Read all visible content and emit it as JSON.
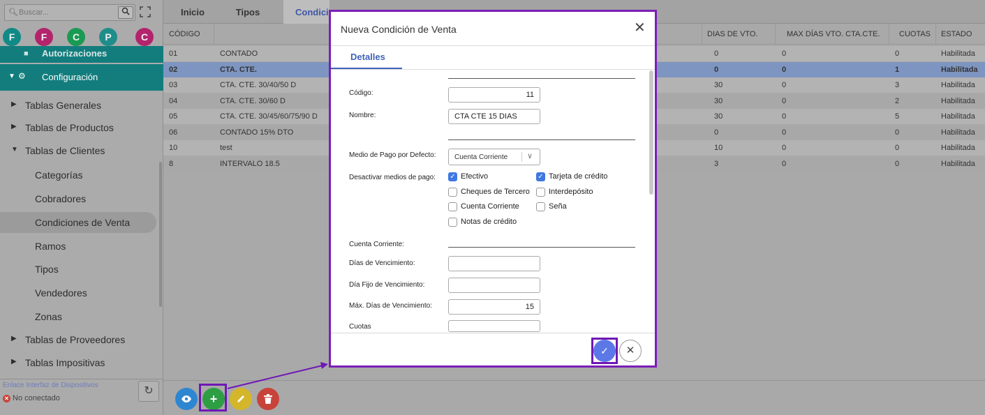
{
  "sidebar": {
    "search_placeholder": "Buscar...",
    "circles": [
      {
        "letter": "F",
        "color": "#0f8a87"
      },
      {
        "letter": "F",
        "color": "#b3246d"
      },
      {
        "letter": "C",
        "color": "#1a9a52"
      },
      {
        "letter": "P",
        "color": "#1f8e8a"
      },
      {
        "letter": "C",
        "color": "#b3246d"
      }
    ],
    "autorizaciones": "Autorizaciones",
    "configuracion": "Configuración",
    "items": [
      {
        "label": "Tablas Generales"
      },
      {
        "label": "Tablas de Productos"
      },
      {
        "label": "Tablas de Clientes"
      }
    ],
    "subitems": [
      {
        "label": "Categorías"
      },
      {
        "label": "Cobradores"
      },
      {
        "label": "Condiciones de Venta"
      },
      {
        "label": "Ramos"
      },
      {
        "label": "Tipos"
      },
      {
        "label": "Vendedores"
      },
      {
        "label": "Zonas"
      }
    ],
    "items_after": [
      {
        "label": "Tablas de Proveedores"
      },
      {
        "label": "Tablas Impositivas"
      }
    ],
    "device_link_label": "Enlace Interfaz de Dispositivos",
    "device_status": "No conectado"
  },
  "tabs": [
    {
      "label": "Inicio"
    },
    {
      "label": "Tipos"
    },
    {
      "label": "Condici"
    }
  ],
  "table": {
    "headers": {
      "codigo": "CÓDIGO",
      "dias_vto": "DIAS DE VTO.",
      "max_dias": "MAX DÍAS VTO. CTA.CTE.",
      "cuotas": "CUOTAS",
      "estado": "ESTADO"
    },
    "rows": [
      {
        "codigo": "01",
        "nombre": "CONTADO",
        "dias": "0",
        "max": "0",
        "cuotas": "0",
        "estado": "Habilitada"
      },
      {
        "codigo": "02",
        "nombre": "CTA. CTE.",
        "dias": "0",
        "max": "0",
        "cuotas": "1",
        "estado": "Habilitada"
      },
      {
        "codigo": "03",
        "nombre": "CTA. CTE. 30/40/50 D",
        "dias": "30",
        "max": "0",
        "cuotas": "3",
        "estado": "Habilitada"
      },
      {
        "codigo": "04",
        "nombre": "CTA. CTE. 30/60 D",
        "dias": "30",
        "max": "0",
        "cuotas": "2",
        "estado": "Habilitada"
      },
      {
        "codigo": "05",
        "nombre": "CTA. CTE. 30/45/60/75/90 D",
        "dias": "30",
        "max": "0",
        "cuotas": "5",
        "estado": "Habilitada"
      },
      {
        "codigo": "06",
        "nombre": "CONTADO 15% DTO",
        "dias": "0",
        "max": "0",
        "cuotas": "0",
        "estado": "Habilitada"
      },
      {
        "codigo": "10",
        "nombre": "test",
        "dias": "10",
        "max": "0",
        "cuotas": "0",
        "estado": "Habilitada"
      },
      {
        "codigo": "8",
        "nombre": "INTERVALO 18.5",
        "dias": "3",
        "max": "0",
        "cuotas": "0",
        "estado": "Habilitada"
      }
    ]
  },
  "actions": {
    "view_icon": "eye-icon",
    "add_icon": "plus-icon",
    "edit_icon": "pencil-icon",
    "delete_icon": "trash-icon",
    "colors": {
      "view": "#2e86d1",
      "add": "#2e9e45",
      "edit": "#d4b62a",
      "delete": "#c8433a"
    }
  },
  "modal": {
    "title": "Nueva Condición de Venta",
    "tab": "Detalles",
    "codigo_label": "Código:",
    "codigo_value": "11",
    "nombre_label": "Nombre:",
    "nombre_value": "CTA CTE 15 DIAS",
    "medio_label": "Medio de Pago por Defecto:",
    "medio_value": "Cuenta Corriente",
    "desactivar_label": "Desactivar medios de pago:",
    "checkboxes": [
      {
        "label": "Efectivo",
        "checked": true
      },
      {
        "label": "Tarjeta de crédito",
        "checked": true
      },
      {
        "label": "Cheques de Tercero",
        "checked": false
      },
      {
        "label": "Interdepósito",
        "checked": false
      },
      {
        "label": "Cuenta Corriente",
        "checked": false
      },
      {
        "label": "Seña",
        "checked": false
      },
      {
        "label": "Notas de crédito",
        "checked": false
      }
    ],
    "cuenta_corriente_label": "Cuenta Corriente:",
    "dias_venc_label": "Días de Vencimiento:",
    "dias_venc_value": "",
    "dia_fijo_label": "Día Fijo de Vencimiento:",
    "dia_fijo_value": "",
    "max_dias_label": "Máx. Días de Vencimiento:",
    "max_dias_value": "15",
    "cuotas_label": "Cuotas"
  }
}
